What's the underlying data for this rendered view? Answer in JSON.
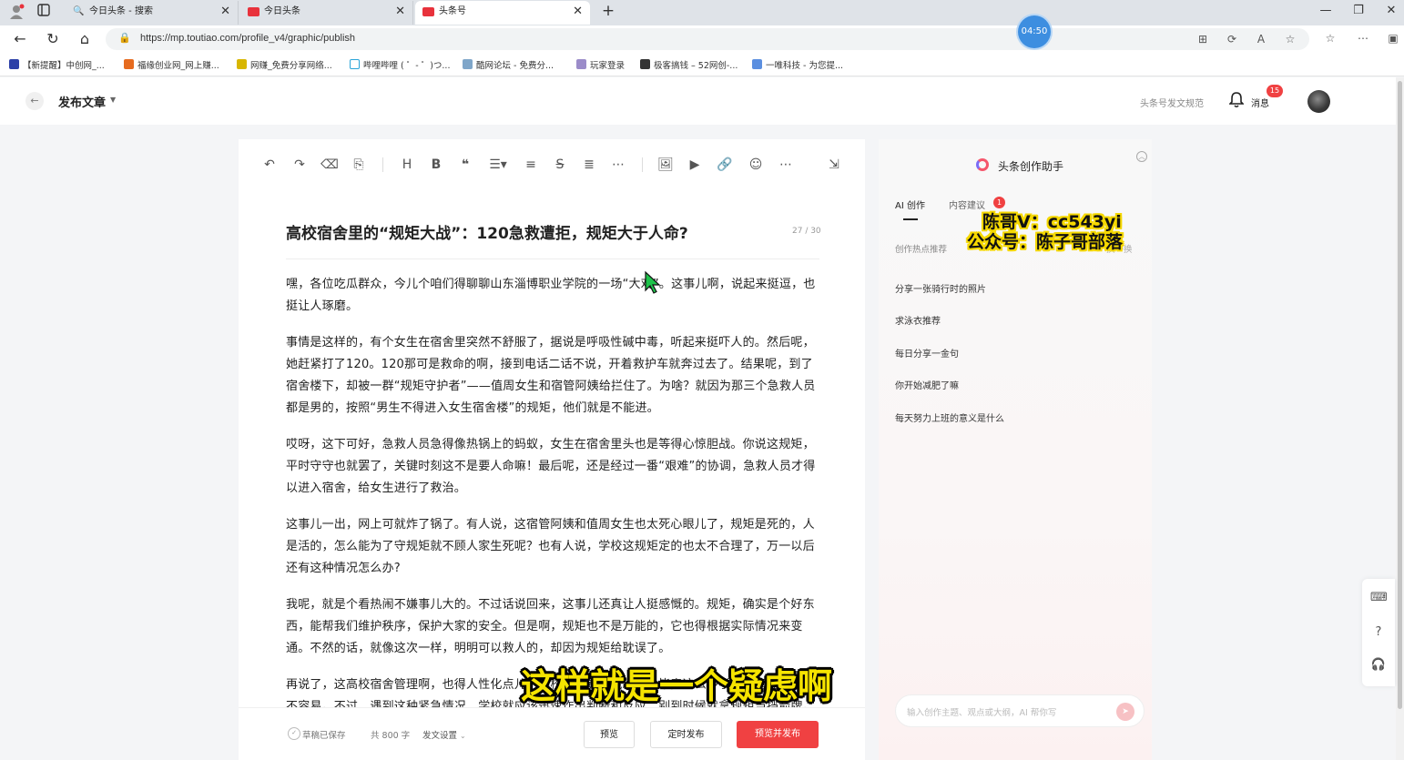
{
  "browser": {
    "tabs": [
      {
        "label": "今日头条 - 搜索"
      },
      {
        "label": "今日头条"
      },
      {
        "label": "头条号"
      }
    ],
    "url": "https://mp.toutiao.com/profile_v4/graphic/publish",
    "timer": "04:50",
    "bookmarks": [
      {
        "label": "【新提醒】中创网_..."
      },
      {
        "label": "福缘创业网_网上赚..."
      },
      {
        "label": "网赚_免费分享网络..."
      },
      {
        "label": "哔哩哔哩 ( ゜- ゜)つ..."
      },
      {
        "label": "酷网论坛 - 免费分..."
      },
      {
        "label": "玩家登录"
      },
      {
        "label": "极客搞钱 – 52网创-..."
      },
      {
        "label": "一唯科技 - 为您提..."
      }
    ]
  },
  "header": {
    "title": "发布文章",
    "rules_link": "头条号发文规范",
    "messages_label": "消息",
    "messages_count": "15"
  },
  "editor": {
    "title": "高校宿舍里的“规矩大战”：120急救遭拒，规矩大于人命?",
    "title_count": "27 / 30",
    "paragraphs": [
      "嘿，各位吃瓜群众，今儿个咱们得聊聊山东淄博职业学院的一场“大戏”。这事儿啊，说起来挺逗，也挺让人琢磨。",
      "事情是这样的，有个女生在宿舍里突然不舒服了，据说是呼吸性碱中毒，听起来挺吓人的。然后呢，她赶紧打了120。120那可是救命的啊，接到电话二话不说，开着救护车就奔过去了。结果呢，到了宿舍楼下，却被一群“规矩守护者”——值周女生和宿管阿姨给拦住了。为啥？就因为那三个急救人员都是男的，按照“男生不得进入女生宿舍楼”的规矩，他们就是不能进。",
      "哎呀，这下可好，急救人员急得像热锅上的蚂蚁，女生在宿舍里头也是等得心惊胆战。你说这规矩，平时守守也就罢了，关键时刻这不是要人命嘛！最后呢，还是经过一番“艰难”的协调，急救人员才得以进入宿舍，给女生进行了救治。",
      "这事儿一出，网上可就炸了锅了。有人说，这宿管阿姨和值周女生也太死心眼儿了，规矩是死的，人是活的，怎么能为了守规矩就不顾人家生死呢？也有人说，学校这规矩定的也太不合理了，万一以后还有这种情况怎么办?",
      "我呢，就是个看热闹不嫌事儿大的。不过话说回来，这事儿还真让人挺感慨的。规矩，确实是个好东西，能帮我们维护秩序，保护大家的安全。但是啊，规矩也不是万能的，它也得根据实际情况来变通。不然的话，就像这次一样，明明可以救人的，却因为规矩给耽误了。",
      "再说了，这高校宿舍管理啊，也得人性化点儿。学校也不是不能理解，毕竟这么多学生，管理起来也不容易。不过，遇到这种紧急情况，学校就应该迅速作出判断和反应，别到时候就拿规矩当挡箭牌。"
    ],
    "footer": {
      "saved": "草稿已保存",
      "word_count": "共 800 字",
      "publish_settings": "发文设置",
      "preview": "预览",
      "schedule": "定时发布",
      "publish": "预览并发布"
    }
  },
  "assistant": {
    "title": "头条创作助手",
    "tab_ai": "AI 创作",
    "tab_suggest": "内容建议",
    "suggest_badge": "1",
    "hot_label": "创作热点推荐",
    "refresh": "换一换",
    "items": [
      "分享一张骑行时的照片",
      "求泳衣推荐",
      "每日分享一金句",
      "你开始减肥了嘛",
      "每天努力上班的意义是什么"
    ],
    "input_placeholder": "输入创作主题、观点或大纲，AI 帮你写"
  },
  "overlay": {
    "watermark_line1": "陈哥V：cc543yi",
    "watermark_line2": "公众号：陈子哥部落",
    "subtitle": "这样就是一个疑虑啊"
  },
  "colors": {
    "accent_red": "#f04142",
    "subtitle_yellow": "#f5e400",
    "timer_blue": "#3d8ee0"
  }
}
